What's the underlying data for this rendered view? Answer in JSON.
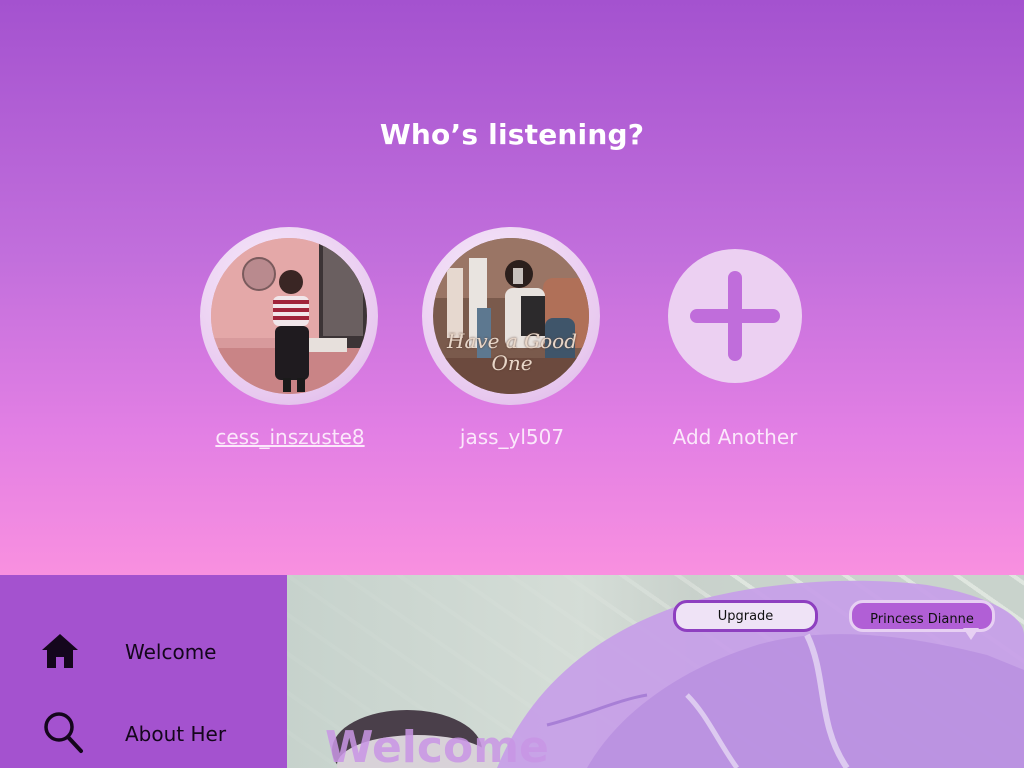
{
  "header": {
    "title": "Who’s listening?"
  },
  "profiles": [
    {
      "username": "cess_inszuste8"
    },
    {
      "username": "jass_yl507",
      "photo_caption": "Have a Good One"
    }
  ],
  "add_profile": {
    "label": "Add Another"
  },
  "sidebar": {
    "items": [
      {
        "label": "Welcome",
        "icon": "home-icon"
      },
      {
        "label": "About Her",
        "icon": "search-icon"
      }
    ]
  },
  "topbar": {
    "upgrade_label": "Upgrade",
    "account_name": "Princess Dianne"
  },
  "hero": {
    "heading": "Welcome"
  },
  "colors": {
    "accent": "#a452cf",
    "gradient_bottom": "#f990e0",
    "add_circle": "#ecd0f2"
  }
}
